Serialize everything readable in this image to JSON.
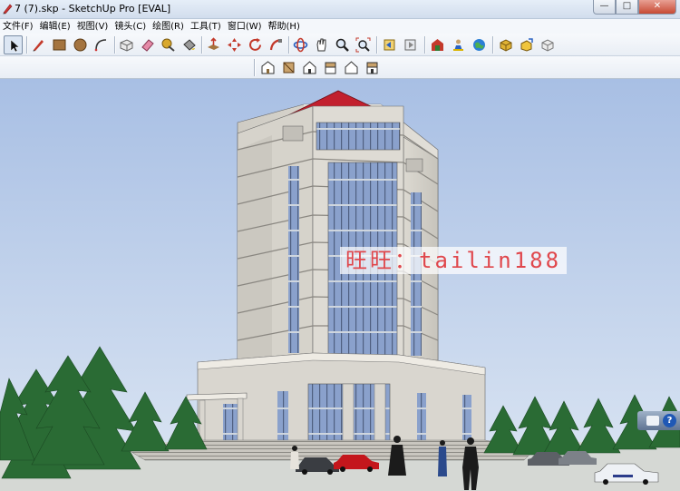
{
  "window": {
    "title": "7 (7).skp - SketchUp Pro [EVAL]",
    "buttons": [
      "minimize",
      "maximize",
      "close"
    ]
  },
  "menu": [
    "文件(F)",
    "编辑(E)",
    "视图(V)",
    "镜头(C)",
    "绘图(R)",
    "工具(T)",
    "窗口(W)",
    "帮助(H)"
  ],
  "toolbar": {
    "groups": [
      [
        "select-icon"
      ],
      [
        "pencil-icon",
        "rectangle-icon",
        "circle-icon",
        "arc-icon"
      ],
      [
        "make-component-icon",
        "eraser-icon",
        "tape-measure-icon",
        "paint-bucket-icon"
      ],
      [
        "push-pull-icon",
        "move-icon",
        "rotate-icon",
        "follow-me-icon"
      ],
      [
        "orbit-icon",
        "pan-icon",
        "zoom-icon",
        "zoom-extents-icon"
      ],
      [
        "previous-view-icon",
        "next-view-icon"
      ],
      [
        "warehouse-icon",
        "photo-texture-icon",
        "geo-location-icon"
      ],
      [
        "extension-icon",
        "share-model-icon",
        "component-icon"
      ]
    ],
    "views": [
      "iso-view-icon",
      "top-view-icon",
      "front-view-icon",
      "right-view-icon",
      "back-view-icon",
      "left-view-icon"
    ]
  },
  "watermark": "旺旺：tailin188",
  "colors": {
    "sky_top": "#a8bfe4",
    "sky_bottom": "#dce6f3",
    "roof": "#c2202e",
    "facade": "#d9d6cf",
    "glass": "#8aa1cc",
    "watermark_text": "#e0474c"
  }
}
